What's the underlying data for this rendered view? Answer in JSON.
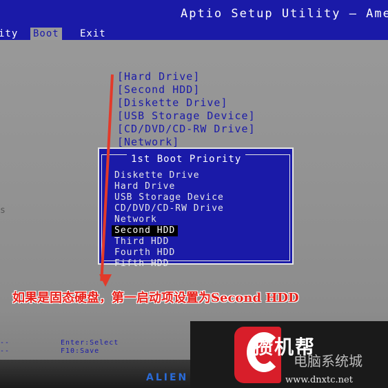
{
  "header": {
    "title": "Aptio Setup Utility – Amer"
  },
  "menu": {
    "items": [
      {
        "label": "ity",
        "active": false
      },
      {
        "label": "Boot",
        "active": true
      },
      {
        "label": "Exit",
        "active": false
      }
    ]
  },
  "boot_priority": {
    "items": [
      "[Hard Drive]",
      "[Second HDD]",
      "[Diskette Drive]",
      "[USB Storage Device]",
      "[CD/DVD/CD-RW Drive]",
      "[Network]"
    ]
  },
  "popup": {
    "title": "1st Boot Priority",
    "options": [
      {
        "label": "Diskette Drive",
        "selected": false
      },
      {
        "label": "Hard Drive",
        "selected": false
      },
      {
        "label": "USB Storage Device",
        "selected": false
      },
      {
        "label": "CD/DVD/CD-RW Drive",
        "selected": false
      },
      {
        "label": "Network",
        "selected": false
      },
      {
        "label": "Second HDD",
        "selected": true
      },
      {
        "label": "Third HDD",
        "selected": false
      },
      {
        "label": "Fourth HDD",
        "selected": false
      },
      {
        "label": "Fifth HDD",
        "selected": false
      }
    ]
  },
  "annotation": {
    "caption": "如果是固态硬盘，第一启动项设置为Second HDD",
    "color": "#e8221c",
    "arrow_color": "#e23a2a",
    "arrow_icon": "arrow-down-icon"
  },
  "help": {
    "line1": "Enter:Select",
    "line2": "F10:Save",
    "left1": "--",
    "left2": "--"
  },
  "side": {
    "text": "s"
  },
  "bezel": {
    "brand": "ALIEN"
  },
  "watermark": {
    "main": "攒机帮",
    "sub": "电脑系统城",
    "url": "www.dnxtc.net",
    "logo_icon": "c-logo-icon"
  },
  "colors": {
    "bios_blue": "#1a1aa8",
    "bios_gray": "#9a9a9a",
    "selection_bg": "#000000"
  }
}
